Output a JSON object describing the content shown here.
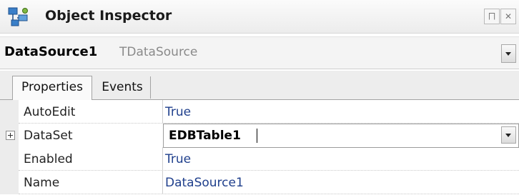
{
  "window": {
    "title": "Object Inspector",
    "pin_icon": "pin-icon",
    "close_icon": "close-icon"
  },
  "selector": {
    "component_name": "DataSource1",
    "component_type": "TDataSource"
  },
  "tabs": [
    {
      "label": "Properties",
      "active": true
    },
    {
      "label": "Events",
      "active": false
    }
  ],
  "properties": [
    {
      "name": "AutoEdit",
      "value": "True",
      "expandable": false,
      "selected": false
    },
    {
      "name": "DataSet",
      "value": "EDBTable1",
      "expandable": true,
      "selected": true
    },
    {
      "name": "Enabled",
      "value": "True",
      "expandable": false,
      "selected": false
    },
    {
      "name": "Name",
      "value": "DataSource1",
      "expandable": false,
      "selected": false
    }
  ],
  "colors": {
    "value_text": "#1f3f8c",
    "gutter": "#ececec"
  }
}
